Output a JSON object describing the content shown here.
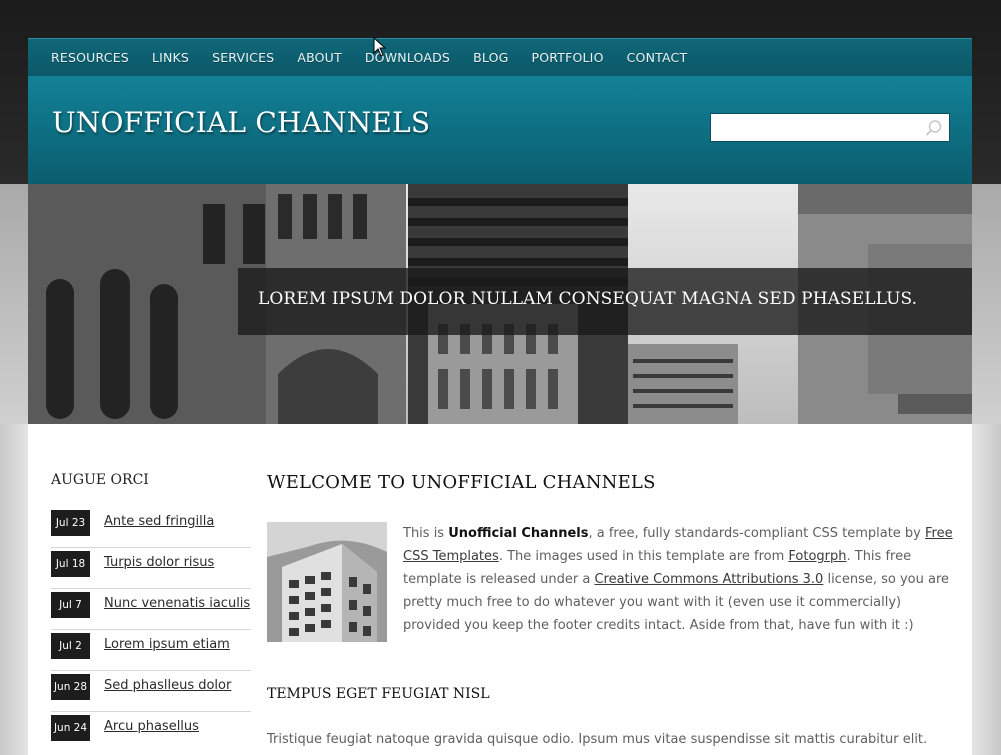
{
  "nav": {
    "items": [
      "RESOURCES",
      "LINKS",
      "SERVICES",
      "ABOUT",
      "DOWNLOADS",
      "BLOG",
      "PORTFOLIO",
      "CONTACT"
    ]
  },
  "header": {
    "site_title": "UNOFFICIAL CHANNELS",
    "search_value": "",
    "search_icon": "search-icon"
  },
  "banner": {
    "caption": "LOREM IPSUM DOLOR NULLAM CONSEQUAT MAGNA SED PHASELLUS."
  },
  "sidebar": {
    "title": "AUGUE ORCI",
    "items": [
      {
        "date": "Jul 23",
        "label": "Ante sed fringilla"
      },
      {
        "date": "Jul 18",
        "label": "Turpis dolor risus"
      },
      {
        "date": "Jul 7",
        "label": "Nunc venenatis iaculis"
      },
      {
        "date": "Jul 2",
        "label": "Lorem ipsum etiam"
      },
      {
        "date": "Jun 28",
        "label": "Sed phaslleus dolor"
      },
      {
        "date": "Jun 24",
        "label": "Arcu phasellus"
      }
    ]
  },
  "main": {
    "title": "WELCOME TO UNOFFICIAL CHANNELS",
    "intro": {
      "t1": "This is ",
      "brand": "Unofficial Channels",
      "t2": ", a free, fully standards-compliant CSS template by ",
      "link1": "Free CSS Templates",
      "t3": ". The images used in this template are from ",
      "link2": "Fotogrph",
      "t4": ". This free template is released under a ",
      "link3": "Creative Commons Attributions 3.0",
      "t5": " license, so you are pretty much free to do whatever you want with it (even use it commercially) provided you keep the footer credits intact. Aside from that, have fun with it :)"
    },
    "subtitle": "TEMPUS EGET FEUGIAT NISL",
    "lead": "Tristique feugiat natoque gravida quisque odio. Ipsum mus vitae suspendisse sit mattis curabitur elit."
  },
  "colors": {
    "nav_bg": "#0b5868",
    "header_bg": "#0f7387",
    "badge_bg": "#1d1d1d"
  }
}
